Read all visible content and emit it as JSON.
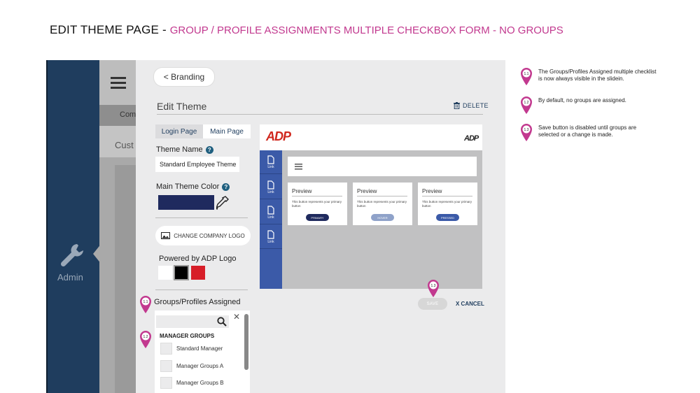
{
  "heading": {
    "main": "EDIT THEME PAGE",
    "separator": " - ",
    "sub": "GROUP / PROFILE ASSIGNMENTS MULTIPLE CHECKBOX FORM - NO GROUPS"
  },
  "background_app": {
    "band_text": "Com",
    "section_text": "Cust",
    "admin_label": "Admin"
  },
  "panel": {
    "back_button": "< Branding",
    "title": "Edit Theme",
    "delete_label": "DELETE",
    "tabs": [
      {
        "label": "Login Page",
        "active": false
      },
      {
        "label": "Main Page",
        "active": true
      }
    ],
    "theme_name_label": "Theme Name",
    "theme_name_value": "Standard Employee Theme",
    "main_color_label": "Main Theme Color",
    "main_color_value": "#1f2a5e",
    "change_logo_label": "CHANGE COMPANY LOGO",
    "powered_label": "Powered by ADP Logo",
    "powered_options": [
      {
        "color": "#ffffff",
        "selected": false
      },
      {
        "color": "#000000",
        "selected": true
      },
      {
        "color": "#d71e28",
        "selected": false
      }
    ],
    "groups_label": "Groups/Profiles Assigned",
    "group_section_title": "MANAGER GROUPS",
    "group_items": [
      {
        "label": "Standard Manager",
        "checked": false
      },
      {
        "label": "Manager Groups A",
        "checked": false
      },
      {
        "label": "Manager Groups B",
        "checked": false
      }
    ],
    "save_label": "SAVE",
    "cancel_label": "X CANCEL"
  },
  "preview": {
    "logo_text": "ADP",
    "small_logo_text": "ADP",
    "side_items": [
      "Link",
      "Link",
      "Link",
      "Link"
    ],
    "cards": [
      {
        "title": "Preview",
        "text": "This button represents your primary button",
        "button": "PRIMARY",
        "button_color": "#1f2a5e"
      },
      {
        "title": "Preview",
        "text": "This button represents your primary button",
        "button": "HOVER",
        "button_color": "#8fa2c9"
      },
      {
        "title": "Preview",
        "text": "This button represents your primary button",
        "button": "PRESSED",
        "button_color": "#3b5aa8"
      }
    ]
  },
  "notes": [
    {
      "number": "1.1",
      "text": "The Groups/Profiles Assigned multiple checklist is now always visible in the slidein."
    },
    {
      "number": "1.2",
      "text": "By default, no groups are assigned."
    },
    {
      "number": "1.3",
      "text": "Save button is disabled until groups are selected or a change is made."
    }
  ],
  "colors": {
    "accent_pink": "#c2398f",
    "nav_blue": "#1f3d5e",
    "preview_blue": "#3b5aa8"
  }
}
